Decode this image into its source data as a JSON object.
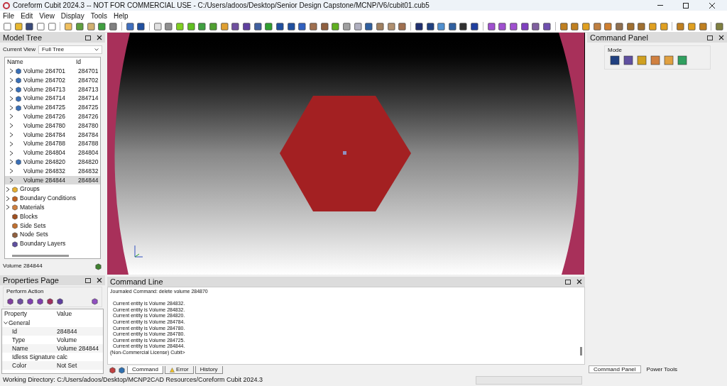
{
  "window": {
    "title": "Coreform Cubit 2024.3 -- NOT FOR COMMERCIAL USE - C:/Users/adoos/Desktop/Senior Design Capstone/MCNP/V6/cubit01.cub5"
  },
  "menu": [
    "File",
    "Edit",
    "View",
    "Display",
    "Tools",
    "Help"
  ],
  "model_tree": {
    "title": "Model Tree",
    "current_view_label": "Current View",
    "current_view": "Full Tree",
    "columns": [
      "Name",
      "Id"
    ],
    "volumes": [
      {
        "name": "Volume 284701",
        "id": "284701",
        "icon": true,
        "selected": false
      },
      {
        "name": "Volume 284702",
        "id": "284702",
        "icon": true,
        "selected": false
      },
      {
        "name": "Volume 284713",
        "id": "284713",
        "icon": true,
        "selected": false
      },
      {
        "name": "Volume 284714",
        "id": "284714",
        "icon": true,
        "selected": false
      },
      {
        "name": "Volume 284725",
        "id": "284725",
        "icon": true,
        "selected": false
      },
      {
        "name": "Volume 284726",
        "id": "284726",
        "icon": false,
        "selected": false
      },
      {
        "name": "Volume 284780",
        "id": "284780",
        "icon": false,
        "selected": false
      },
      {
        "name": "Volume 284784",
        "id": "284784",
        "icon": false,
        "selected": false
      },
      {
        "name": "Volume 284788",
        "id": "284788",
        "icon": false,
        "selected": false
      },
      {
        "name": "Volume 284804",
        "id": "284804",
        "icon": false,
        "selected": false
      },
      {
        "name": "Volume 284820",
        "id": "284820",
        "icon": true,
        "selected": false
      },
      {
        "name": "Volume 284832",
        "id": "284832",
        "icon": false,
        "selected": false
      },
      {
        "name": "Volume 284844",
        "id": "284844",
        "icon": false,
        "selected": true
      }
    ],
    "groups": [
      {
        "name": "Groups",
        "kind": "group",
        "expandable": true
      },
      {
        "name": "Boundary Conditions",
        "kind": "bc",
        "expandable": true
      },
      {
        "name": "Materials",
        "kind": "material",
        "expandable": true
      },
      {
        "name": "Blocks",
        "kind": "block",
        "expandable": false
      },
      {
        "name": "Side Sets",
        "kind": "sideset",
        "expandable": false
      },
      {
        "name": "Node Sets",
        "kind": "nodeset",
        "expandable": false
      },
      {
        "name": "Boundary Layers",
        "kind": "layer",
        "expandable": false
      }
    ],
    "status": "Volume 284844"
  },
  "properties": {
    "title": "Properties Page",
    "action_label": "Perform Action",
    "columns": [
      "Property",
      "Value"
    ],
    "section": {
      "name": "General",
      "expanded": true,
      "rows": [
        {
          "property": "Id",
          "value": "284844"
        },
        {
          "property": "Type",
          "value": "Volume"
        },
        {
          "property": "Name",
          "value": "Volume 284844"
        },
        {
          "property": "Idless Signature",
          "value": "calc"
        },
        {
          "property": "Color",
          "value": "Not Set"
        }
      ]
    }
  },
  "command_line": {
    "title": "Command Line",
    "header": "Journaled Command: delete volume 284870",
    "lines": [
      "  Current entity is Volume 284832.",
      "  Current entity is Volume 284832.",
      "  Current entity is Volume 284820.",
      "  Current entity is Volume 284784.",
      "  Current entity is Volume 284780.",
      "  Current entity is Volume 284780.",
      "  Current entity is Volume 284725.",
      "  Current entity is Volume 284844.",
      "(Non-Commercial License) Cubit>"
    ],
    "tabs": [
      {
        "label": "Command",
        "kind": "text",
        "selected": true
      },
      {
        "label": "Error",
        "kind": "warning",
        "selected": false
      },
      {
        "label": "History",
        "kind": "text",
        "selected": false
      }
    ]
  },
  "command_panel": {
    "title": "Command Panel",
    "mode_label": "Mode",
    "tabs": [
      {
        "label": "Command Panel",
        "selected": true
      },
      {
        "label": "Power Tools",
        "selected": false
      }
    ]
  },
  "status_bar": "Working Directory: C:/Users/adoos/Desktop/MCNP2CAD Resources/Coreform Cubit 2024.3"
}
